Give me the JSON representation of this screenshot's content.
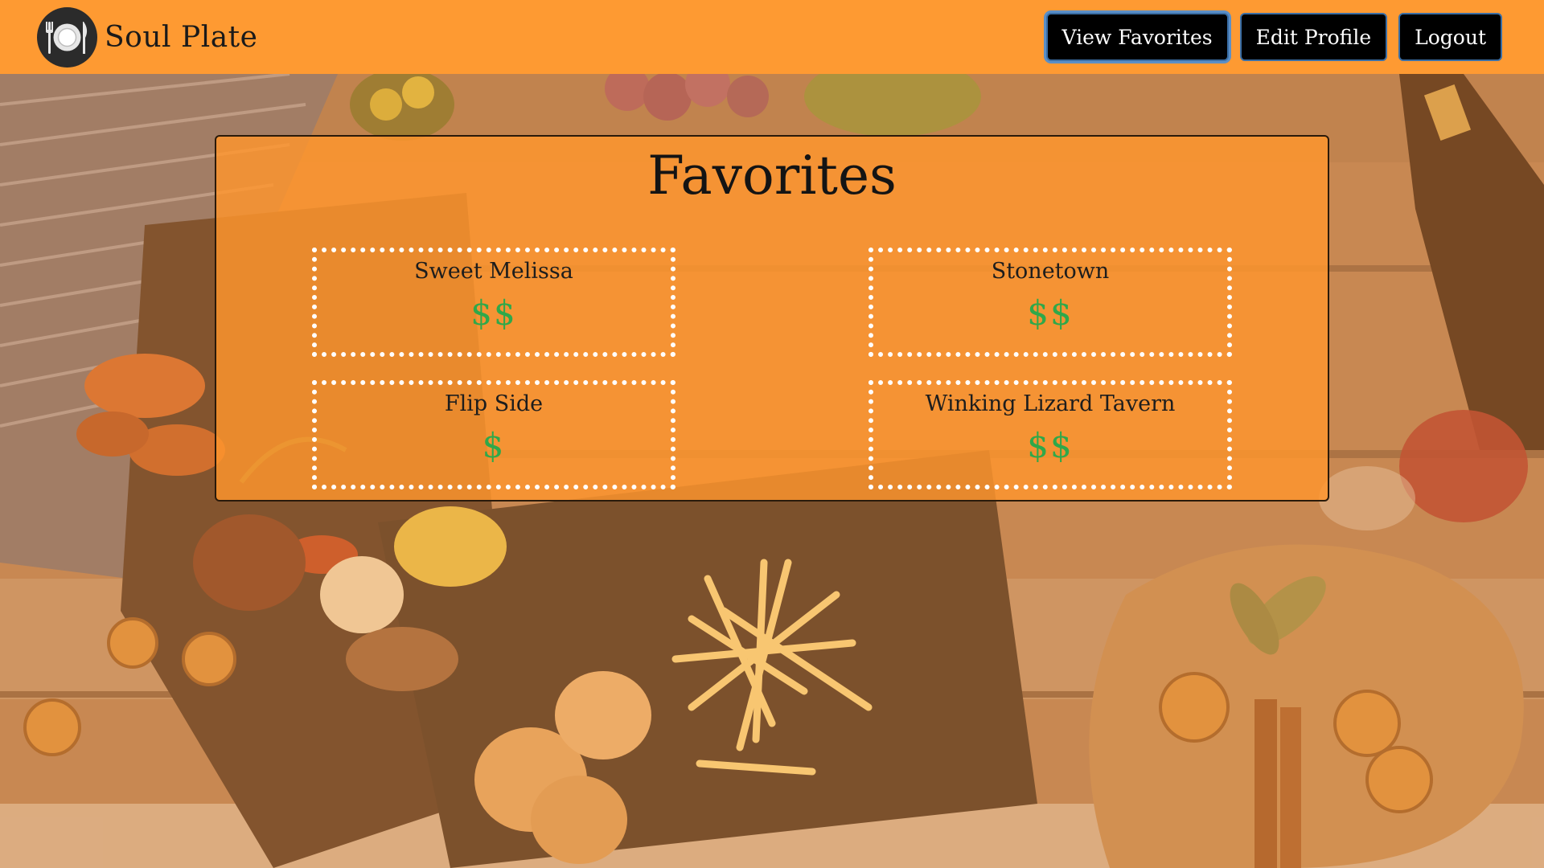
{
  "header": {
    "brand_name": "Soul Plate",
    "logo_icon": "plate-fork-knife-icon",
    "buttons": {
      "view_favorites": "View Favorites",
      "edit_profile": "Edit Profile",
      "logout": "Logout"
    }
  },
  "main": {
    "title": "Favorites",
    "favorites": [
      {
        "name": "Sweet Melissa",
        "price": "$$"
      },
      {
        "name": "Stonetown",
        "price": "$$"
      },
      {
        "name": "Flip Side",
        "price": "$"
      },
      {
        "name": "Winking Lizard Tavern",
        "price": "$$"
      }
    ]
  },
  "colors": {
    "navbar": "#fe9a32",
    "panel": "#ff962d",
    "button": "#000000",
    "price": "#2fa84a",
    "card_border": "#ffffff"
  }
}
